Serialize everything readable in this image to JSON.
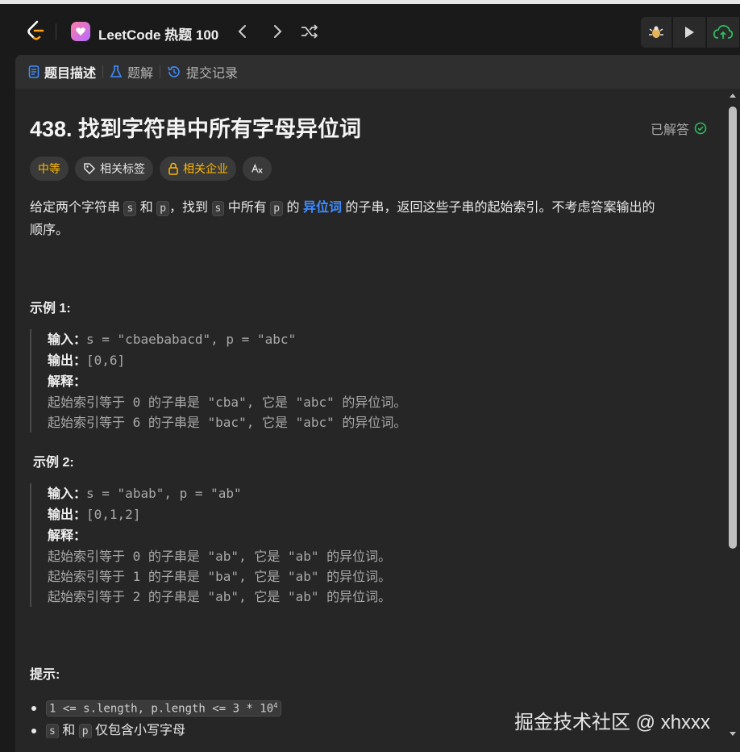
{
  "topbar": {
    "title": "LeetCode 热题 100"
  },
  "tabs": [
    {
      "label": "题目描述"
    },
    {
      "label": "题解"
    },
    {
      "label": "提交记录"
    }
  ],
  "problem": {
    "title": "438. 找到字符串中所有字母异位词",
    "status": "已解答",
    "difficulty": "中等",
    "tags_label": "相关标签",
    "company_label": "相关企业",
    "desc": {
      "t1": "给定两个字符串",
      "s": "s",
      "and": "和",
      "p": "p",
      "t2": "，找到",
      "t3": "中所有",
      "t4": "的",
      "link": "异位词",
      "t5": "的子串，返回这些子串的起始索引。不考虑答案输出的",
      "t6": "顺序。"
    },
    "example1": {
      "heading": "示例 1:",
      "input_label": "输入：",
      "input": "s = \"cbaebabacd\", p = \"abc\"",
      "output_label": "输出：",
      "output": "[0,6]",
      "explain_label": "解释：",
      "lines": [
        "起始索引等于 0 的子串是 \"cba\", 它是 \"abc\" 的异位词。",
        "起始索引等于 6 的子串是 \"bac\", 它是 \"abc\" 的异位词。"
      ]
    },
    "example2": {
      "heading": "示例 2:",
      "input_label": "输入：",
      "input": "s = \"abab\", p = \"ab\"",
      "output_label": "输出：",
      "output": "[0,1,2]",
      "explain_label": "解释：",
      "lines": [
        "起始索引等于 0 的子串是 \"ab\", 它是 \"ab\" 的异位词。",
        "起始索引等于 1 的子串是 \"ba\", 它是 \"ab\" 的异位词。",
        "起始索引等于 2 的子串是 \"ab\", 它是 \"ab\" 的异位词。"
      ]
    },
    "hints_heading": "提示:",
    "constraint1": "1 <= s.length, p.length <= 3 * 10",
    "constraint1_exp": "4",
    "constraint2_s": "s",
    "constraint2_and": "和",
    "constraint2_p": "p",
    "constraint2_text": "仅包含小写字母"
  },
  "watermark": "掘金技术社区 @ xhxxx",
  "colors": {
    "accent_link": "#3f8cff",
    "difficulty_medium": "#ffb800",
    "solved_check": "#2cbb5d",
    "submit_green": "#2cbb5d"
  }
}
